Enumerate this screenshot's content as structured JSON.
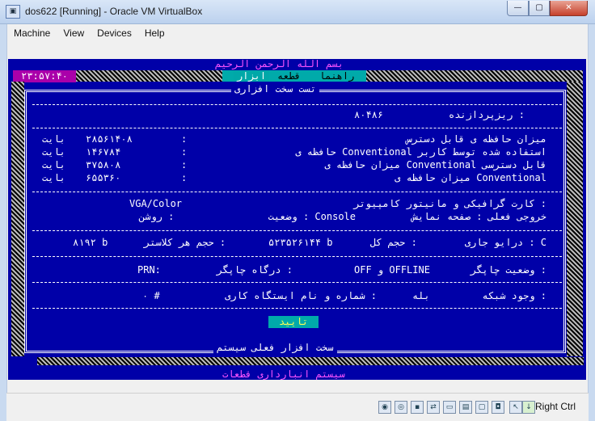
{
  "window": {
    "title": "dos622 [Running] - Oracle VM VirtualBox",
    "min_glyph": "—",
    "max_glyph": "▢",
    "close_glyph": "✕"
  },
  "menu": [
    "Machine",
    "View",
    "Devices",
    "Help"
  ],
  "dos": {
    "bismillah": "بسم الله الرحمن الرحيم",
    "clock": "۲۳:۵۷:۴۰",
    "menu_items": [
      "راهنما",
      "قطعه",
      "ابزار"
    ],
    "dialog_title": "تست سخت افزاری",
    "cpu_label": "ریزپردازنده :",
    "cpu_value": "۸۰۴۸۶",
    "mem_rows": [
      {
        "label": "میزان حافظه ی قابل دسترس",
        "value": "۲۸۵۶۱۴۰۸",
        "unit": "بایت"
      },
      {
        "label": "حافظه ی Conventional استفاده شده توسط کاربر",
        "value": "۱۴۶۷۸۴",
        "unit": "بایت"
      },
      {
        "label": "میزان حافظه ی Conventional قابل دسترسی",
        "value": "۳۷۵۸۰۸",
        "unit": "بایت"
      },
      {
        "label": "میزان حافظه ی Conventional",
        "value": "۶۵۵۳۶۰",
        "unit": "بایت"
      }
    ],
    "graphics_label": "کارت گرافیکی و مانیتور کامپیوتر :",
    "graphics_value": "VGA/Color",
    "output_label": "خروجی فعلی : صفحه نمایش",
    "mode_label": "وضعیت : Console",
    "mode_value": "روشن :",
    "drive_label": "درایو جاری : C",
    "drive_total_label": "حجم کل :",
    "drive_total_value": "۵۲۳۵۲۶۱۴۴ b",
    "cluster_label": "حجم هر کلاستر :",
    "cluster_value": "۸۱۹۲ b",
    "printer_status_label": "وضعیت چاپگر :",
    "printer_status_value": "OFF و OFFLINE",
    "printer_port_label": "درگاه چاپگر :",
    "printer_port_value": "PRN:",
    "network_label": "وجود شبکه :",
    "network_value": "بله",
    "station_label": "شماره و نام ایستگاه کاری :",
    "station_value": "۰ #",
    "ok_button": "تایید",
    "footer_title": "سخت افزار فعلی سیستم",
    "bottom_title": "سیستم انبارداری قطعات"
  },
  "statusbar": {
    "host_key": "Right Ctrl"
  }
}
